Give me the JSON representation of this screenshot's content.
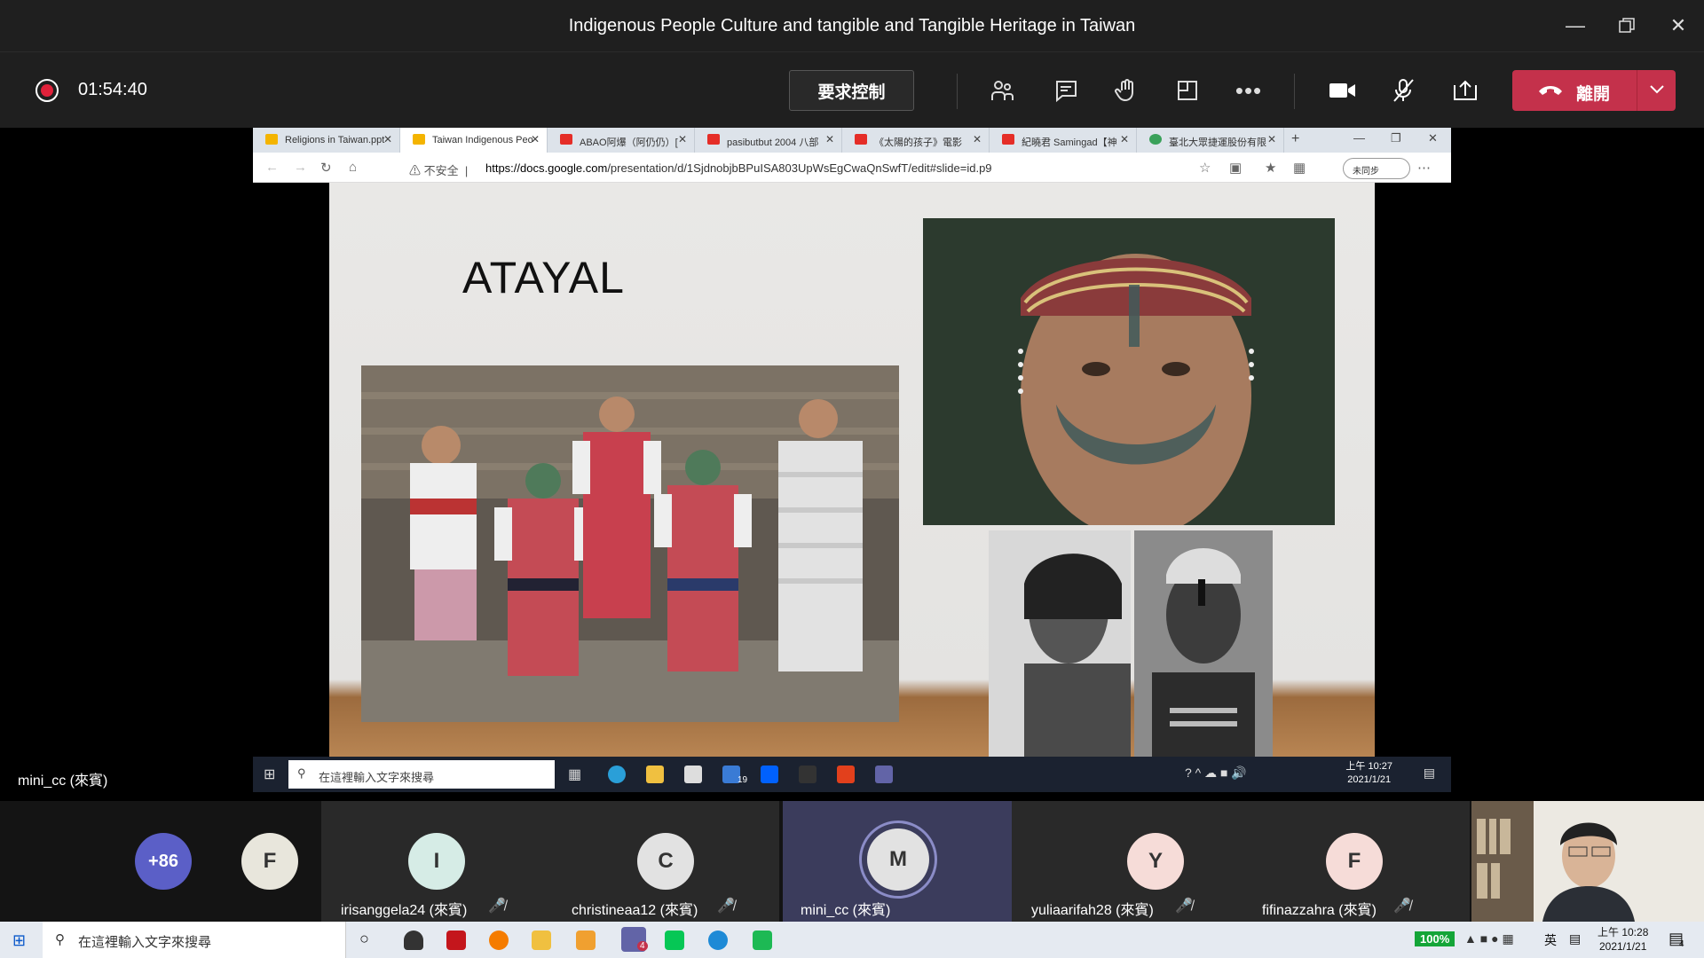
{
  "window": {
    "title": "Indigenous People Culture and tangible and Tangible Heritage in Taiwan",
    "controls": [
      "minimize",
      "restore",
      "close"
    ]
  },
  "meeting": {
    "elapsed": "01:54:40",
    "request_control_label": "要求控制",
    "leave_label": "離開",
    "accent_leave": "#c4314b"
  },
  "browser": {
    "tabs": [
      {
        "label": "Religions in Taiwan.ppt",
        "icon": "slides-icon",
        "active": false
      },
      {
        "label": "Taiwan Indigenous Peo",
        "icon": "slides-icon",
        "active": true
      },
      {
        "label": "ABAO阿爆（阿仍仍）[",
        "icon": "youtube-icon",
        "active": false
      },
      {
        "label": "pasibutbut 2004 八部",
        "icon": "youtube-icon",
        "active": false
      },
      {
        "label": "《太陽的孩子》電影",
        "icon": "youtube-icon",
        "active": false
      },
      {
        "label": "紀曉君 Samingad【神",
        "icon": "youtube-icon",
        "active": false
      },
      {
        "label": "臺北大眾捷運股份有限",
        "icon": "web-icon",
        "active": false
      }
    ],
    "security_label": "不安全",
    "url_host": "https://docs.google.com",
    "url_path": "/presentation/d/1SjdnobjbBPuISA803UpWsEgCwaQnSwfT/edit#slide=id.p9",
    "sync_label": "未同步"
  },
  "slide": {
    "title": "ATAYAL"
  },
  "inner_taskbar": {
    "search_placeholder": "在這裡輸入文字來搜尋",
    "time": "上午 10:27",
    "date": "2021/1/21",
    "mail_badge": "19"
  },
  "presenter": {
    "name": "mini_cc (來賓)"
  },
  "participants": {
    "overflow": "+86",
    "list": [
      {
        "initial": "F",
        "name": "",
        "color": "#e8e6dc",
        "muted": false
      },
      {
        "initial": "I",
        "name": "irisanggela24 (來賓)",
        "color": "#d6ece6",
        "muted": true
      },
      {
        "initial": "C",
        "name": "christineaa12 (來賓)",
        "color": "#e2e2e2",
        "muted": true
      },
      {
        "initial": "M",
        "name": "mini_cc (來賓)",
        "color": "#e2e2e2",
        "muted": false
      },
      {
        "initial": "Y",
        "name": "yuliaarifah28 (來賓)",
        "color": "#f6dcd8",
        "muted": true
      },
      {
        "initial": "F",
        "name": "fifinazzahra (來賓)",
        "color": "#f6dcd8",
        "muted": true
      }
    ]
  },
  "os_taskbar": {
    "search_placeholder": "在這裡輸入文字來搜尋",
    "battery": "100%",
    "ime": "英",
    "time": "上午 10:28",
    "date": "2021/1/21",
    "teams_badge": "4",
    "notif_badge": "4"
  }
}
